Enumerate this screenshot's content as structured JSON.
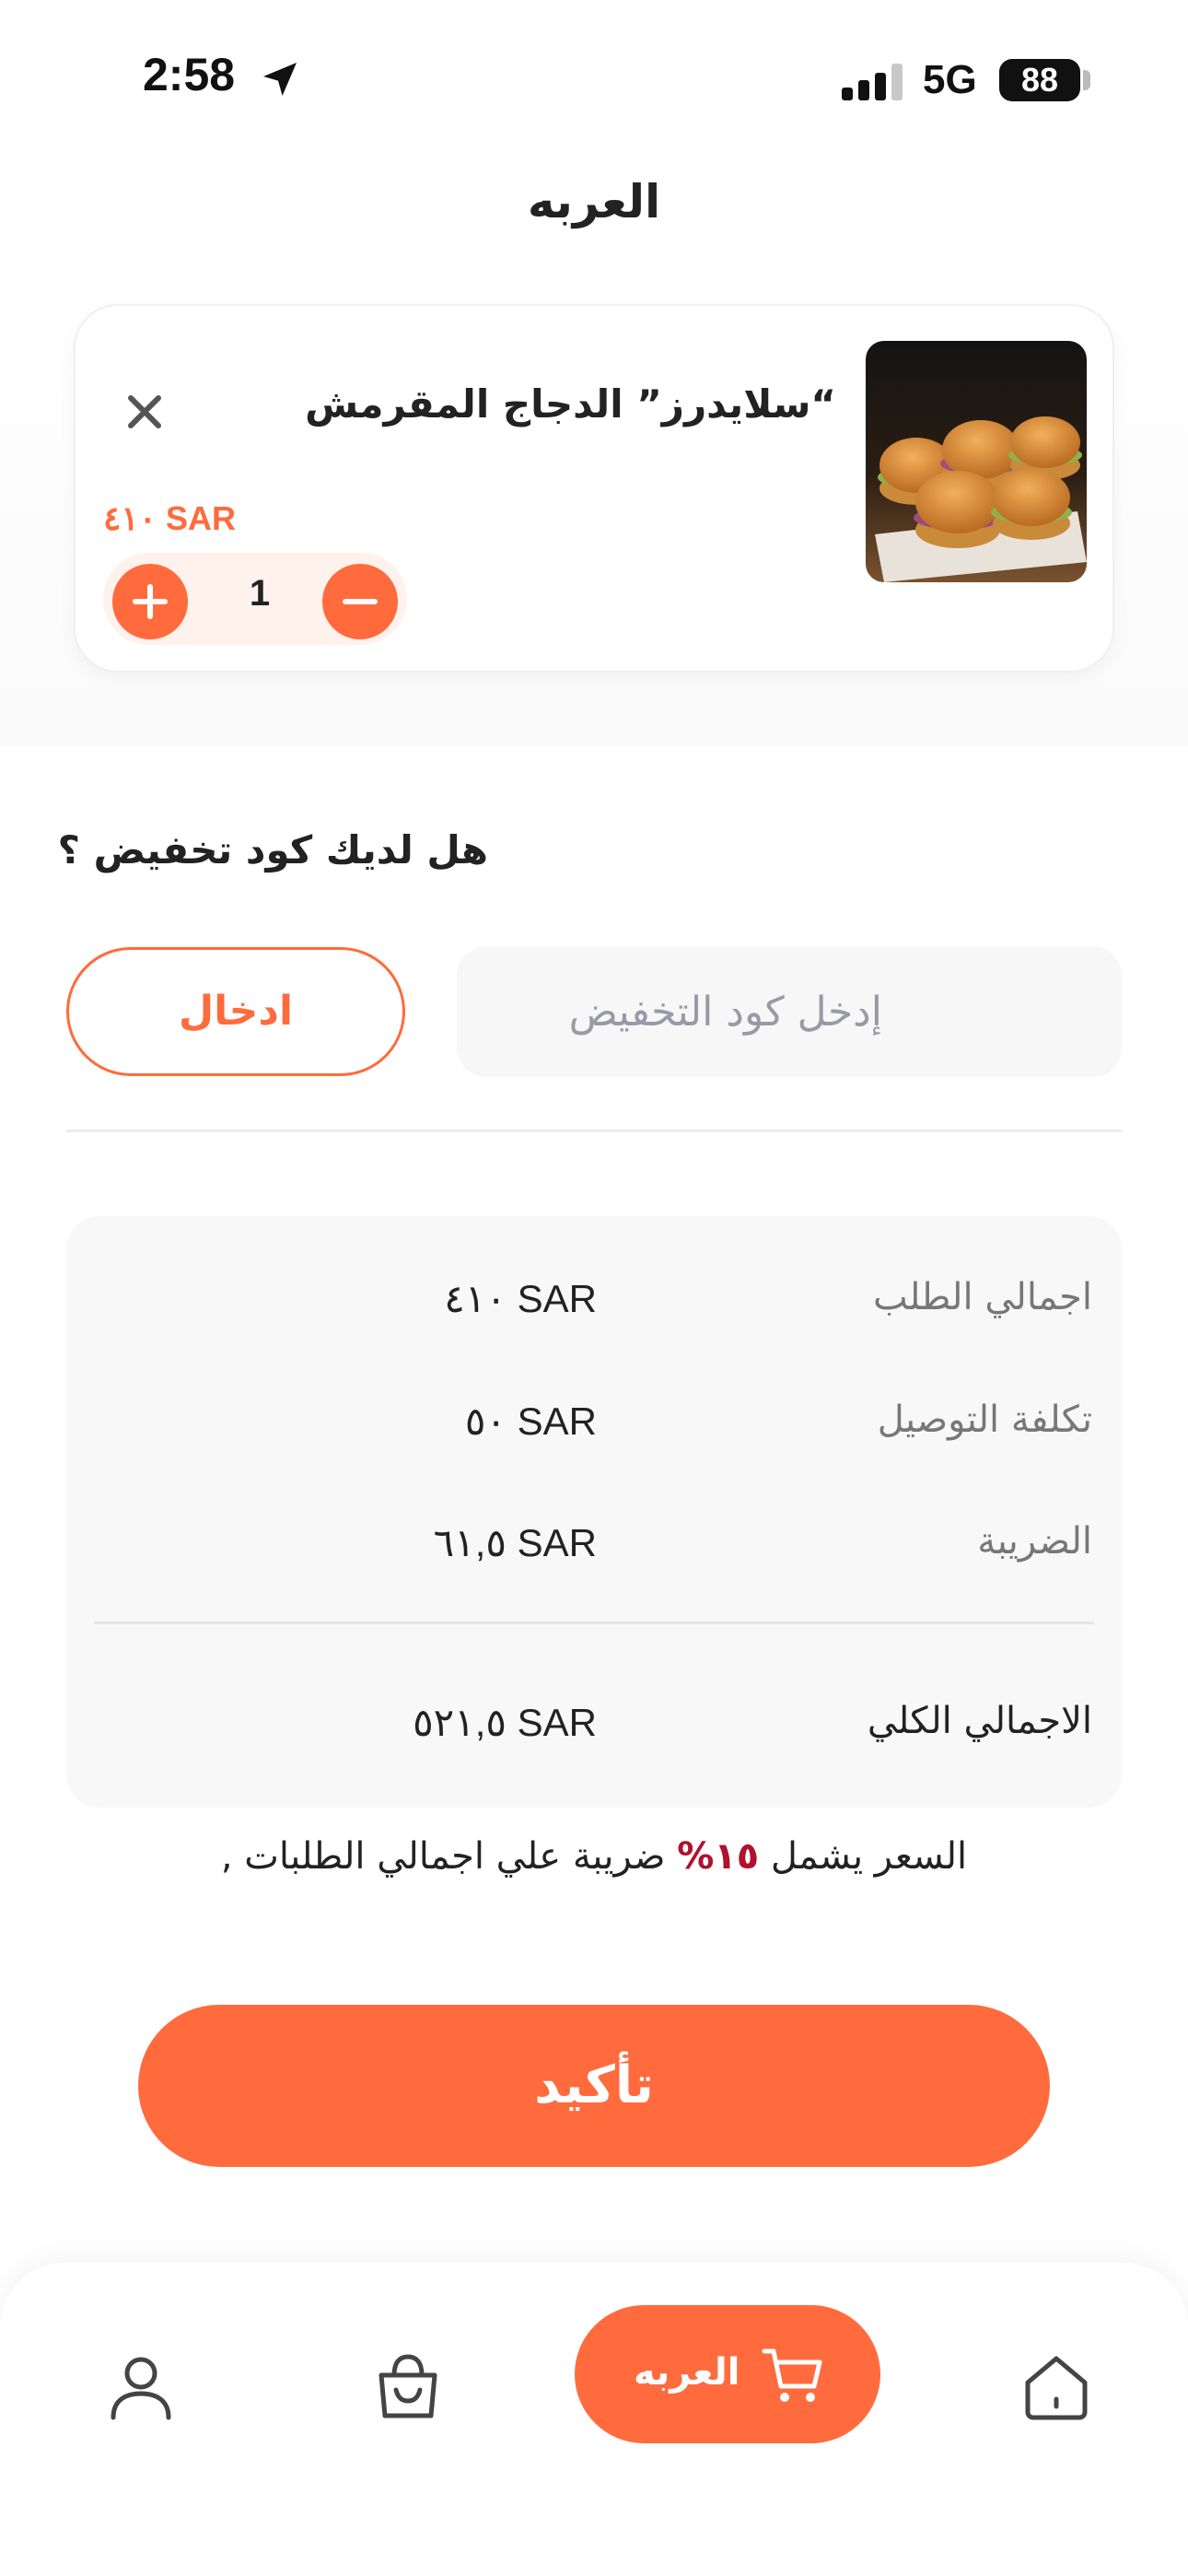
{
  "status_bar": {
    "time": "2:58",
    "network": "5G",
    "battery": "88"
  },
  "header": {
    "title": "العربه"
  },
  "cart": {
    "items": [
      {
        "name": "“سلايدرز” الدجاج المقرمش",
        "price": "٤١٠ SAR",
        "quantity": "1"
      }
    ]
  },
  "discount": {
    "title": "هل لديك كود تخفيض ؟",
    "input_placeholder": "إدخل كود التخفيض",
    "apply_label": "ادخال"
  },
  "summary": {
    "order_total_label": "اجمالي الطلب",
    "order_total_value": "٤١٠ SAR",
    "delivery_label": "تكلفة التوصيل",
    "delivery_value": "٥٠ SAR",
    "tax_label": "الضريبة",
    "tax_value": "٦١,٥ SAR",
    "grand_total_label": "الاجمالي الكلي",
    "grand_total_value": "٥٢١,٥ SAR"
  },
  "tax_note": {
    "prefix": "السعر يشمل",
    "percent": "١٥%",
    "suffix": "ضريبة علي اجمالي الطلبات ,"
  },
  "confirm_label": "تأكيد",
  "bottom_nav": {
    "cart_label": "العربه"
  },
  "colors": {
    "accent": "#FF6B3D",
    "accent_light": "#FFF1EC",
    "tax_highlight": "#B0112E"
  },
  "icons": [
    "location-arrow-icon",
    "signal-icon",
    "close-icon",
    "plus-icon",
    "minus-icon",
    "profile-icon",
    "shopping-bag-icon",
    "cart-icon",
    "home-icon"
  ]
}
